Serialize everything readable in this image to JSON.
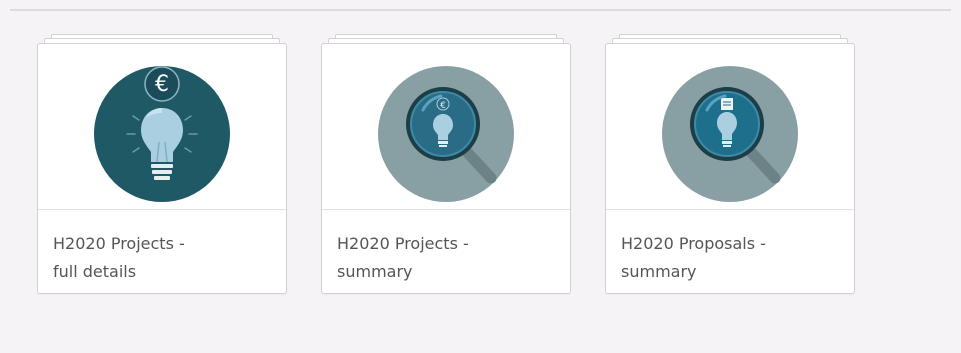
{
  "apps": [
    {
      "title": "H2020 Projects -\nfull details",
      "icon": "euro-lightbulb-icon",
      "circle_color": "#1f5966",
      "bulb_color": "#a9cfe0"
    },
    {
      "title": "H2020 Projects -\nsummary",
      "icon": "magnifier-euro-lightbulb-icon",
      "circle_color": "#889fa3",
      "lens_color": "#2a6c86"
    },
    {
      "title": "H2020 Proposals -\nsummary",
      "icon": "magnifier-document-lightbulb-icon",
      "circle_color": "#889fa3",
      "lens_color": "#1e6f8c"
    }
  ]
}
